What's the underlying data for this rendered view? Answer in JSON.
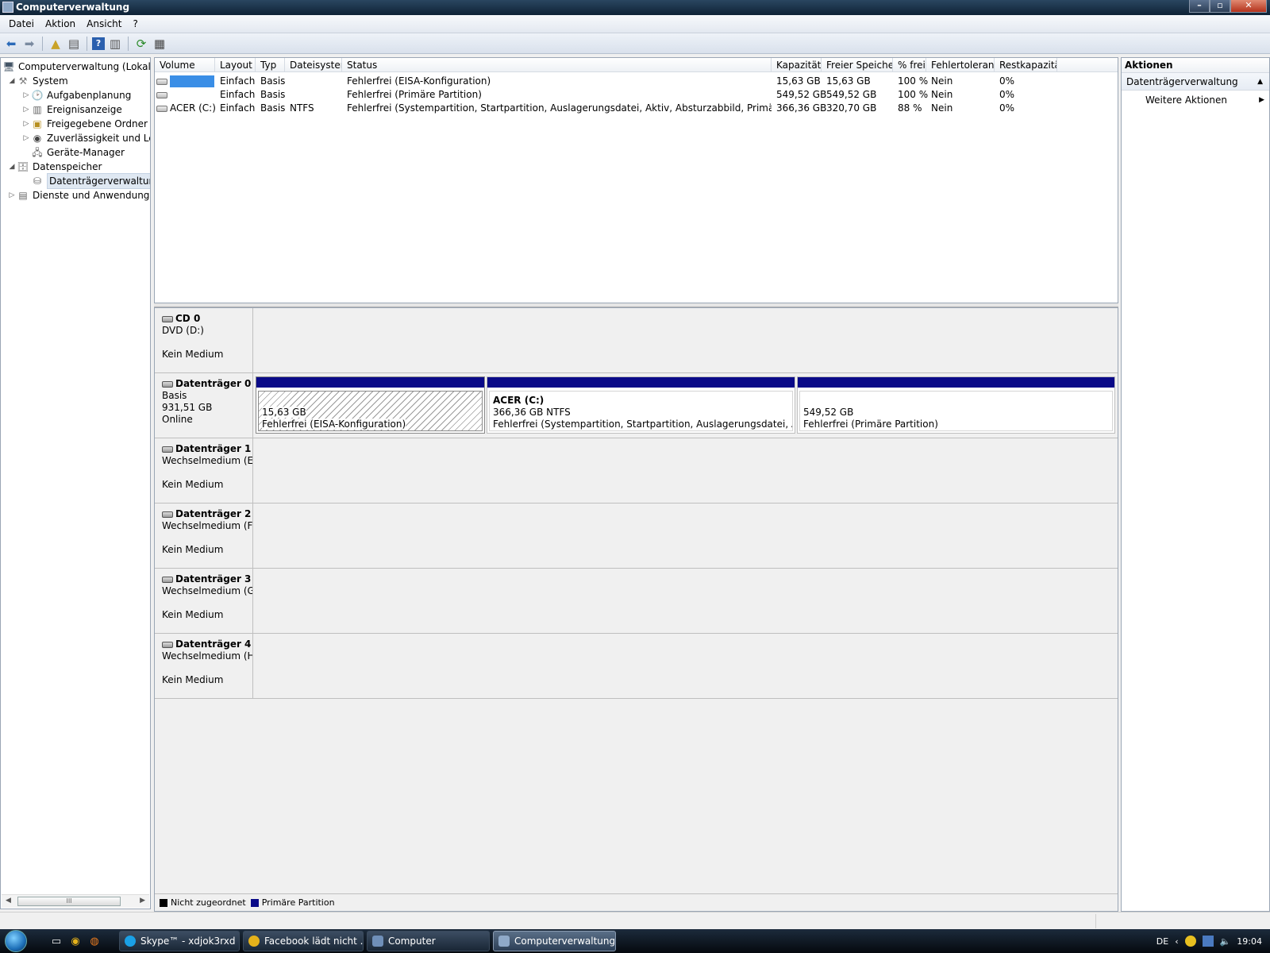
{
  "window": {
    "title": "Computerverwaltung"
  },
  "menu": [
    "Datei",
    "Aktion",
    "Ansicht",
    "?"
  ],
  "tree": {
    "root": "Computerverwaltung (Lokal)",
    "system": "System",
    "aufgaben": "Aufgabenplanung",
    "ereignis": "Ereignisanzeige",
    "ordner": "Freigegebene Ordner",
    "zuver": "Zuverlässigkeit und Leis",
    "geraete": "Geräte-Manager",
    "datenspeicher": "Datenspeicher",
    "datentraeger": "Datenträgerverwaltung",
    "dienste": "Dienste und Anwendungen",
    "scroll_thumb": "III"
  },
  "volumes": {
    "headers": [
      "Volume",
      "Layout",
      "Typ",
      "Dateisystem",
      "Status",
      "Kapazität",
      "Freier Speicher",
      "% frei",
      "Fehlertoleranz",
      "Restkapazität"
    ],
    "rows": [
      {
        "volume": "",
        "layout": "Einfach",
        "typ": "Basis",
        "fs": "",
        "status": "Fehlerfrei (EISA-Konfiguration)",
        "kap": "15,63 GB",
        "frei": "15,63 GB",
        "pct": "100 %",
        "ft": "Nein",
        "rest": "0%"
      },
      {
        "volume": "",
        "layout": "Einfach",
        "typ": "Basis",
        "fs": "",
        "status": "Fehlerfrei (Primäre Partition)",
        "kap": "549,52 GB",
        "frei": "549,52 GB",
        "pct": "100 %",
        "ft": "Nein",
        "rest": "0%"
      },
      {
        "volume": "ACER (C:)",
        "layout": "Einfach",
        "typ": "Basis",
        "fs": "NTFS",
        "status": "Fehlerfrei (Systempartition, Startpartition, Auslagerungsdatei, Aktiv, Absturzabbild, Primäre Partition)",
        "kap": "366,36 GB",
        "frei": "320,70 GB",
        "pct": "88 %",
        "ft": "Nein",
        "rest": "0%"
      }
    ]
  },
  "disks": {
    "cd0": {
      "name": "CD 0",
      "line1": "DVD (D:)",
      "line3": "Kein Medium"
    },
    "d0": {
      "name": "Datenträger 0",
      "line1": "Basis",
      "line2": "931,51 GB",
      "line3": "Online",
      "p1": {
        "size": "15,63 GB",
        "status": "Fehlerfrei (EISA-Konfiguration)"
      },
      "p2": {
        "name": "ACER  (C:)",
        "size": "366,36 GB NTFS",
        "status": "Fehlerfrei (Systempartition, Startpartition, Auslagerungsdatei, Aktiv, Ab"
      },
      "p3": {
        "size": "549,52 GB",
        "status": "Fehlerfrei (Primäre Partition)"
      }
    },
    "d1": {
      "name": "Datenträger 1",
      "line1": "Wechselmedium (E:",
      "line3": "Kein Medium"
    },
    "d2": {
      "name": "Datenträger 2",
      "line1": "Wechselmedium (F:",
      "line3": "Kein Medium"
    },
    "d3": {
      "name": "Datenträger 3",
      "line1": "Wechselmedium (G:",
      "line3": "Kein Medium"
    },
    "d4": {
      "name": "Datenträger 4",
      "line1": "Wechselmedium (H:",
      "line3": "Kein Medium"
    }
  },
  "legend": {
    "unalloc": "Nicht zugeordnet",
    "primary": "Primäre Partition"
  },
  "actions": {
    "header": "Aktionen",
    "section": "Datenträgerverwaltung",
    "more": "Weitere Aktionen"
  },
  "taskbar": {
    "tasks": [
      "Skype™ - xdjok3rxd",
      "Facebook lädt nicht ...",
      "Computer",
      "Computerverwaltung"
    ],
    "lang": "DE",
    "time": "19:04"
  },
  "colors": {
    "primary_partition": "#0a0a88",
    "unallocated": "#000000",
    "selection": "#3a8ee6"
  }
}
